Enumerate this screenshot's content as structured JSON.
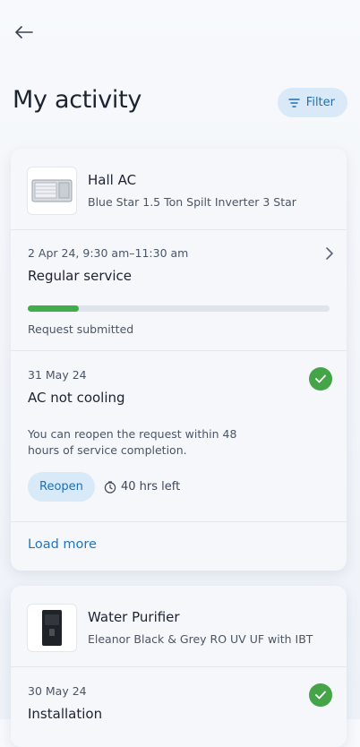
{
  "header": {
    "title": "My activity",
    "filter_label": "Filter"
  },
  "cards": [
    {
      "product_name": "Hall AC",
      "product_model": "Blue Star 1.5 Ton Spilt Inverter 3 Star",
      "requests": [
        {
          "date": "2 Apr 24, 9:30 am–11:30 am",
          "title": "Regular service",
          "status": "Request submitted",
          "progress": 0.17
        },
        {
          "date": "31 May 24",
          "title": "AC not cooling",
          "note": "You can reopen the request within 48 hours of service completion.",
          "reopen_label": "Reopen",
          "time_left": "40 hrs left"
        }
      ],
      "load_more_label": "Load more"
    },
    {
      "product_name": "Water Purifier",
      "product_model": "Eleanor Black & Grey RO UV UF with IBT",
      "requests": [
        {
          "date": "30 May 24",
          "title": "Installation"
        }
      ]
    }
  ],
  "colors": {
    "accent": "#1f76c0",
    "success": "#44a447",
    "pill_bg": "#d8e9f7"
  }
}
